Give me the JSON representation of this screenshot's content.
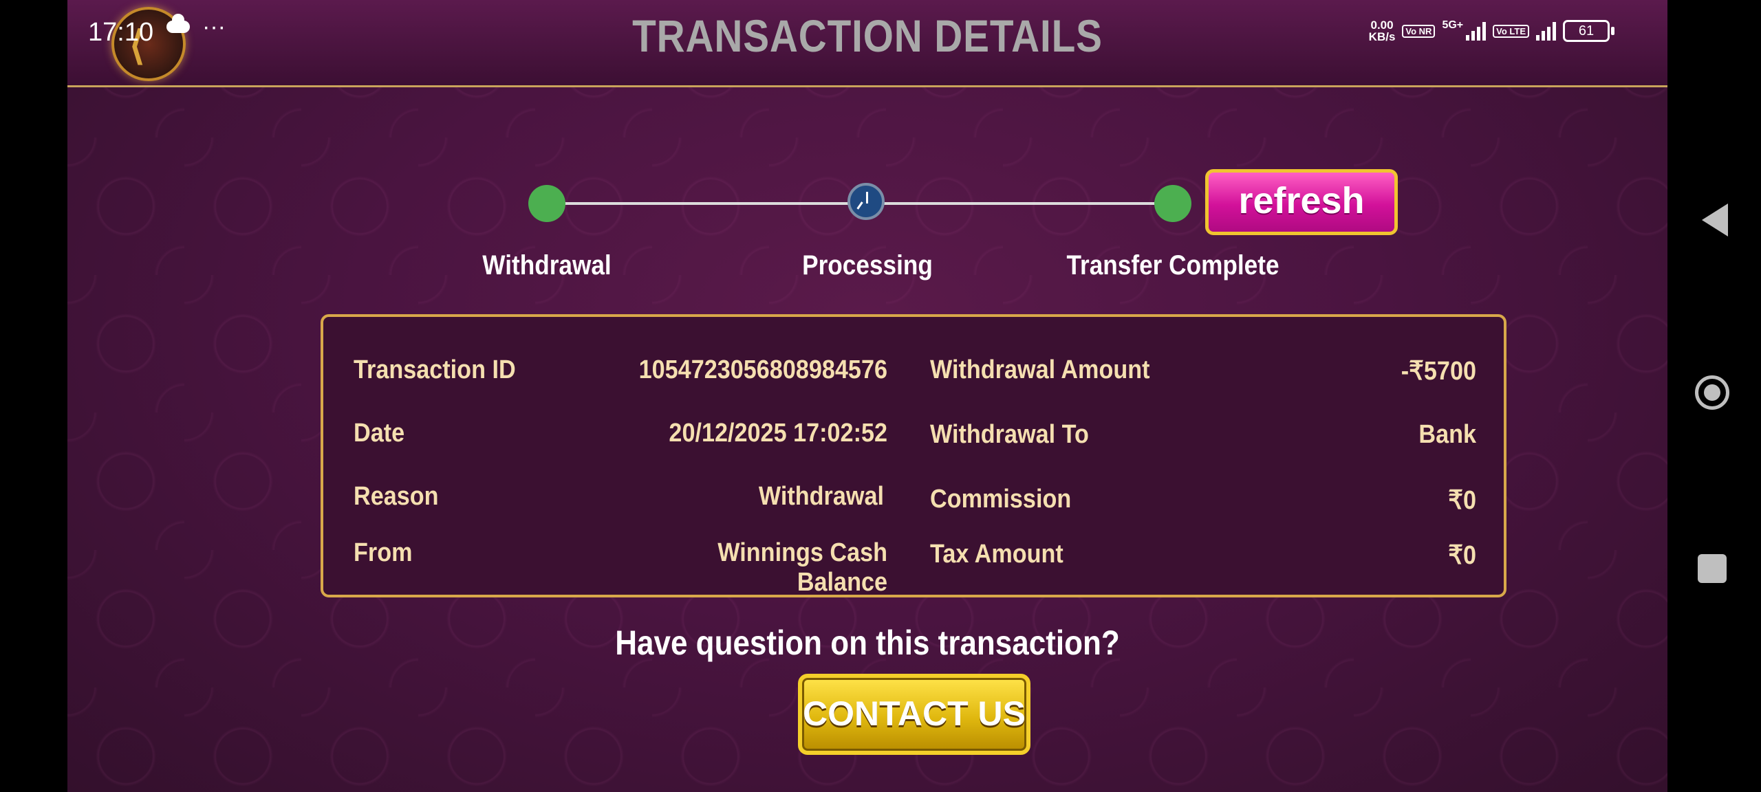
{
  "status_bar": {
    "time": "17:10",
    "more": "···",
    "net_speed_value": "0.00",
    "net_speed_unit": "KB/s",
    "volte_nr": "Vo NR",
    "network": "5G+",
    "volte_lte": "Vo LTE",
    "battery": "61"
  },
  "header": {
    "title": "TRANSACTION DETAILS"
  },
  "stepper": {
    "steps": [
      {
        "label": "Withdrawal",
        "state": "done"
      },
      {
        "label": "Processing",
        "state": "pending"
      },
      {
        "label": "Transfer Complete",
        "state": "done"
      }
    ],
    "refresh_label": "refresh"
  },
  "details": {
    "left": [
      {
        "label": "Transaction ID",
        "value": "1054723056808984576"
      },
      {
        "label": "Date",
        "value": "20/12/2025 17:02:52"
      },
      {
        "label": "Reason",
        "value": "Withdrawal"
      },
      {
        "label": "From",
        "value": "Winnings Cash Balance"
      }
    ],
    "right": [
      {
        "label": "Withdrawal Amount",
        "value": "-₹5700"
      },
      {
        "label": "Withdrawal To",
        "value": "Bank"
      },
      {
        "label": "Commission",
        "value": "₹0"
      },
      {
        "label": "Tax Amount",
        "value": "₹0"
      }
    ]
  },
  "footer": {
    "question": "Have question on this transaction?",
    "contact_label": "CONTACT US"
  },
  "colors": {
    "accent_gold": "#d8a84a",
    "refresh_pink": "#d2119a",
    "contact_yellow": "#e0b80f",
    "step_done": "#4caf50"
  }
}
